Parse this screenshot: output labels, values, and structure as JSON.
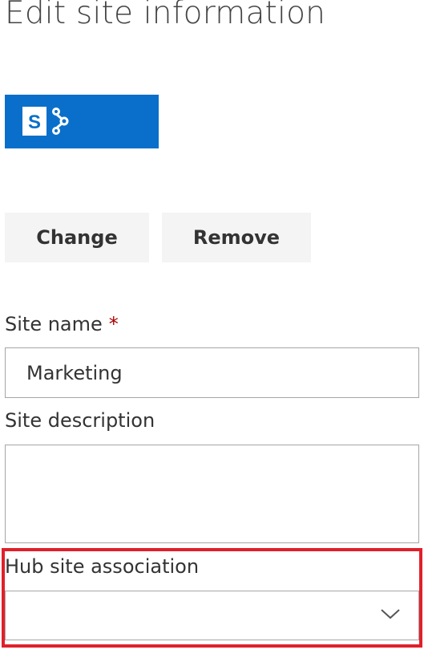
{
  "header": {
    "title": "Edit site information"
  },
  "logo": {
    "icon": "sharepoint-logo-icon",
    "letter": "S",
    "color": "#0a6fca"
  },
  "buttons": {
    "change_label": "Change",
    "remove_label": "Remove"
  },
  "form": {
    "site_name": {
      "label": "Site name",
      "required_marker": "*",
      "value": "Marketing"
    },
    "site_description": {
      "label": "Site description",
      "value": ""
    },
    "hub_site_association": {
      "label": "Hub site association",
      "selected": "",
      "icon": "chevron-down-icon"
    }
  },
  "colors": {
    "highlight": "#e0202b",
    "required": "#a80000",
    "button_bg": "#f4f4f4"
  }
}
